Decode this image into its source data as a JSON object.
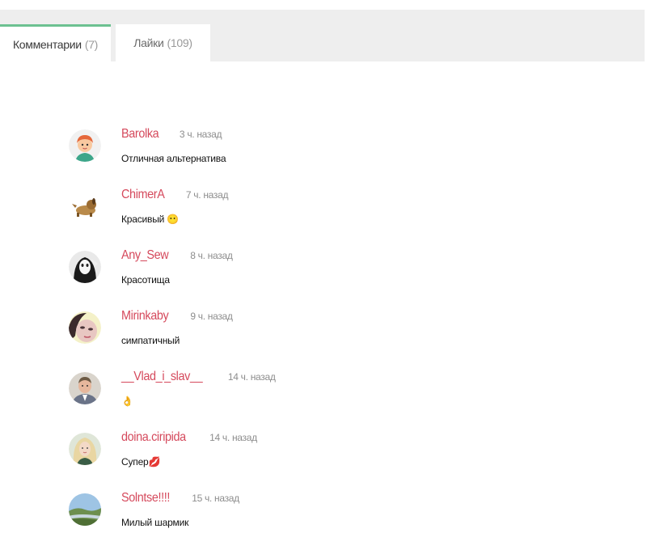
{
  "tabs": [
    {
      "label": "Комментарии",
      "count": "(7)"
    },
    {
      "label": "Лайки",
      "count": "(109)"
    }
  ],
  "comments": [
    {
      "username": "Barolka",
      "time": "3 ч. назад",
      "text": "Отличная альтернатива",
      "avatar": "cartoon-boy-avatar"
    },
    {
      "username": "ChimerA",
      "time": "7 ч. назад",
      "text": "Красивый 😶",
      "avatar": "dog-avatar"
    },
    {
      "username": "Any_Sew",
      "time": "8 ч. назад",
      "text": "Красотища",
      "avatar": "masked-figure-avatar"
    },
    {
      "username": "Mirinkaby",
      "time": "9 ч. назад",
      "text": "симпатичный",
      "avatar": "woman-face-avatar"
    },
    {
      "username": "__Vlad_i_slav__",
      "time": "14 ч. назад",
      "text": "👌",
      "avatar": "man-portrait-avatar"
    },
    {
      "username": "doina.ciripida",
      "time": "14 ч. назад",
      "text": "Супер💋",
      "avatar": "blonde-woman-avatar"
    },
    {
      "username": "Solntse!!!!",
      "time": "15 ч. назад",
      "text": "Милый шармик",
      "avatar": "landscape-avatar"
    }
  ],
  "colors": {
    "accent": "#6cc191",
    "username": "#d5495c",
    "time": "#8d8d8d",
    "tab_bar": "#eeeeee"
  }
}
